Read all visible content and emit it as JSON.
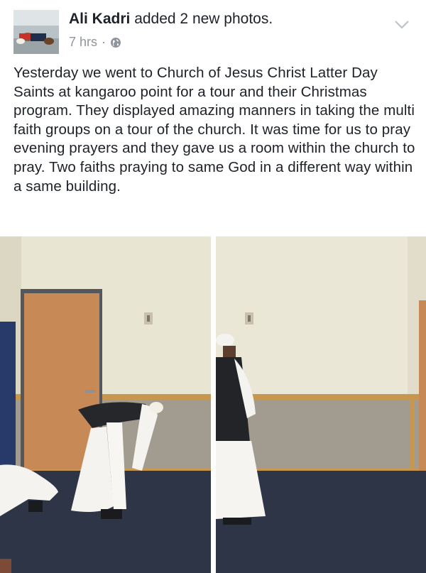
{
  "post": {
    "author": "Ali Kadri",
    "action": "added 2 new photos.",
    "timestamp": "7 hrs",
    "separator": "·",
    "privacy_icon": "globe-icon",
    "menu_icon": "chevron-down-icon",
    "text": "Yesterday we went to Church of Jesus Christ Latter Day Saints at kangaroo point for a tour and their Christmas program. They displayed amazing manners in taking the multi faith groups on a tour of the church. It was time for us to pray evening prayers and they gave us a room within the church to pray. Two faiths praying to same God in a different way within a same building."
  },
  "photos": [
    {
      "name": "photo-1"
    },
    {
      "name": "photo-2"
    }
  ],
  "colors": {
    "text": "#1d2129",
    "meta": "#90949c",
    "wall": "#eae7d6",
    "carpet": "#2e3547",
    "door": "#c48a55"
  }
}
